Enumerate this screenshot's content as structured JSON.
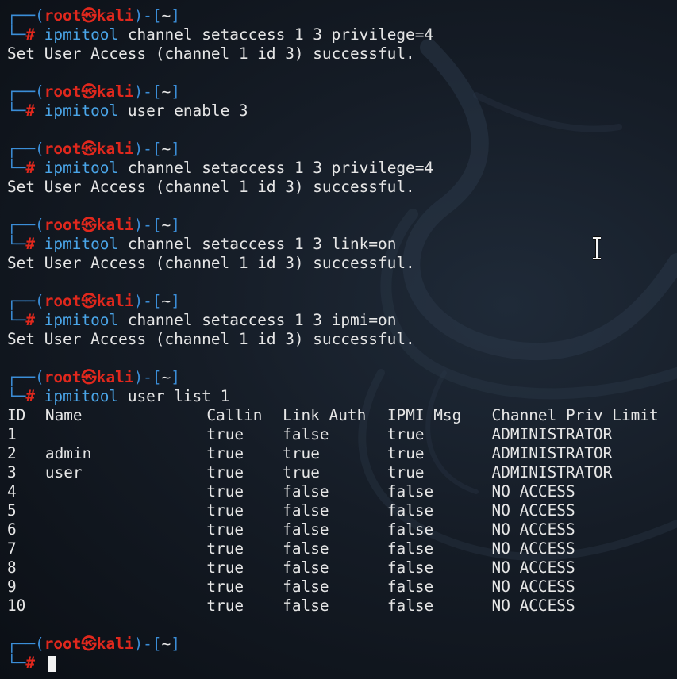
{
  "prompt": {
    "open": "┌──(",
    "user": "root",
    "skull": "㉿",
    "host": "kali",
    "mid": ")-[",
    "dir": "~",
    "close": "]",
    "hook": "└─",
    "hash": "#"
  },
  "blocks": [
    {
      "cmd": "ipmitool",
      "args": "channel setaccess 1 3 privilege=4",
      "output": "Set User Access (channel 1 id 3) successful."
    },
    {
      "cmd": "ipmitool",
      "args": "user enable 3",
      "output": ""
    },
    {
      "cmd": "ipmitool",
      "args": "channel setaccess 1 3 privilege=4",
      "output": "Set User Access (channel 1 id 3) successful."
    },
    {
      "cmd": "ipmitool",
      "args": "channel setaccess 1 3 link=on",
      "output": "Set User Access (channel 1 id 3) successful."
    },
    {
      "cmd": "ipmitool",
      "args": "channel setaccess 1 3 ipmi=on",
      "output": "Set User Access (channel 1 id 3) successful."
    },
    {
      "cmd": "ipmitool",
      "args": "user list 1",
      "output": ""
    }
  ],
  "user_table": {
    "headers": [
      "ID",
      "Name",
      "Callin",
      "Link Auth",
      "IPMI Msg",
      "Channel Priv Limit"
    ],
    "rows": [
      [
        "1",
        "",
        "true",
        "false",
        "true",
        "ADMINISTRATOR"
      ],
      [
        "2",
        "admin",
        "true",
        "true",
        "true",
        "ADMINISTRATOR"
      ],
      [
        "3",
        "user",
        "true",
        "true",
        "true",
        "ADMINISTRATOR"
      ],
      [
        "4",
        "",
        "true",
        "false",
        "false",
        "NO ACCESS"
      ],
      [
        "5",
        "",
        "true",
        "false",
        "false",
        "NO ACCESS"
      ],
      [
        "6",
        "",
        "true",
        "false",
        "false",
        "NO ACCESS"
      ],
      [
        "7",
        "",
        "true",
        "false",
        "false",
        "NO ACCESS"
      ],
      [
        "8",
        "",
        "true",
        "false",
        "false",
        "NO ACCESS"
      ],
      [
        "9",
        "",
        "true",
        "false",
        "false",
        "NO ACCESS"
      ],
      [
        "10",
        "",
        "true",
        "false",
        "false",
        "NO ACCESS"
      ]
    ]
  },
  "colors": {
    "background": "#0d1117",
    "prompt_bracket": "#3b8ed8",
    "prompt_user": "#e0281d",
    "command": "#4aa5e8",
    "text": "#e6e6e6"
  },
  "icons": {
    "background": "kali-dragon-icon",
    "pointer": "text-cursor-ibeam-icon"
  }
}
